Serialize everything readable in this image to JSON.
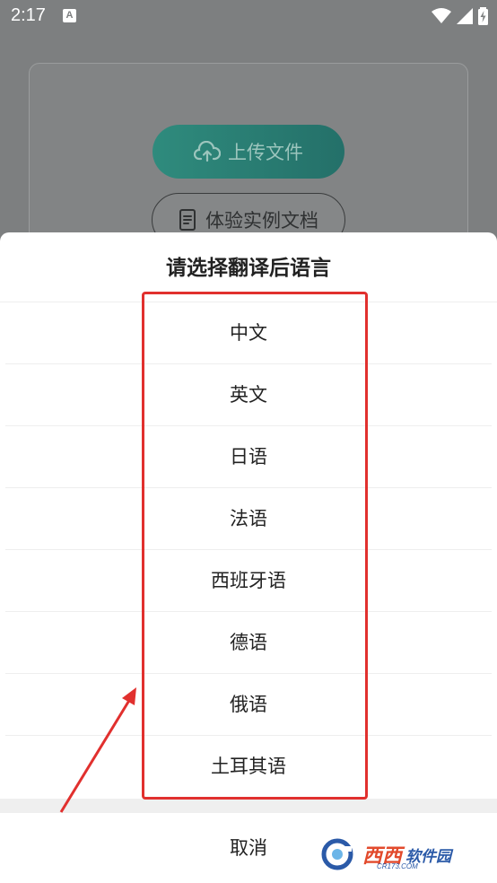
{
  "status_bar": {
    "time": "2:17",
    "notification_badge": "A",
    "icons": [
      "wifi-icon",
      "signal-icon",
      "battery-charging-icon"
    ]
  },
  "background_page": {
    "upload_button_label": "上传文件",
    "demo_button_label": "体验实例文档"
  },
  "dialog": {
    "title": "请选择翻译后语言",
    "languages": [
      "中文",
      "英文",
      "日语",
      "法语",
      "西班牙语",
      "德语",
      "俄语",
      "土耳其语"
    ],
    "cancel_label": "取消"
  },
  "watermark": {
    "brand": "西西",
    "sub": "软件园",
    "domain": "CR173.COM"
  },
  "colors": {
    "accent": "#2a8c7d",
    "highlight": "#e1302e",
    "scrim": "#7d7f80"
  }
}
